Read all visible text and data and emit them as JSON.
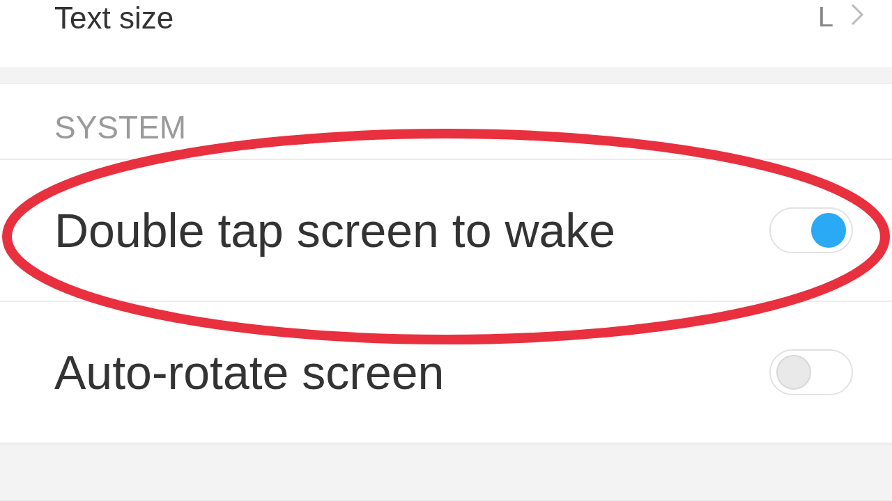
{
  "top_row": {
    "label": "Text size",
    "value": "L"
  },
  "section": {
    "title": "SYSTEM"
  },
  "settings": [
    {
      "label": "Double tap screen to wake",
      "on": true,
      "highlighted": true
    },
    {
      "label": "Auto-rotate screen",
      "on": false,
      "highlighted": false
    }
  ]
}
